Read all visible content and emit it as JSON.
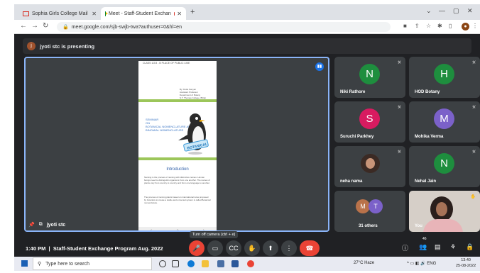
{
  "browser": {
    "tabs": [
      {
        "title": "Sophia Girls College Mail"
      },
      {
        "title": "Meet - Staff-Student Exchan"
      }
    ],
    "new_tab": "+",
    "url": "meet.google.com/sjb-swjb-twa?authuser=0&hl=en"
  },
  "meeting": {
    "presenting_avatar": "j",
    "presenting_text": "jyoti stc is presenting",
    "presenter_name": "jyoti stc",
    "time": "1:40 PM",
    "separator": "|",
    "title": "Staff-Student Exchange Program Aug. 2022",
    "tooltip": "Turn off camera (ctrl + e)",
    "raise_count": "46"
  },
  "document": {
    "cover_header": "CLASS 1/2/3 - B   PLACE OF PUBLIC LINE",
    "cover_lines": [
      "By: Dolat Kanyan",
      "Assistant Professor",
      "Department of Botany",
      "S.T. Thomas College, Bhilai"
    ],
    "page2_title": [
      "SEMINAR",
      "ON",
      "BOTANICAL NOMENCLATURE AND",
      "BINOMIAL NOMENCLATURE"
    ],
    "page2_badge": "BOTANICAL",
    "intro_heading": "Introduction",
    "intro_para1": "Naming is the process of naming with distinctive names. Human beings need to distinguish organisms from one another. The names of plants vary from country to country and from one language to another.",
    "intro_para2": "The process of naming plants based on international rules proposed by botanists to create a stable and universal system is called Botanical nomenclature.",
    "footer_pager": [
      "‹",
      "○",
      "›"
    ]
  },
  "participants": [
    {
      "initial": "N",
      "name": "Niki Rathore",
      "color": "#1e8e3e"
    },
    {
      "initial": "H",
      "name": "HOD Botany",
      "color": "#1e8e3e"
    },
    {
      "initial": "S",
      "name": "Suruchi Parkhey",
      "color": "#d81b60"
    },
    {
      "initial": "M",
      "name": "Mohika Verma",
      "color": "#7b61c9"
    },
    {
      "initial": "",
      "name": "neha nama",
      "color": "#f2f2f2"
    },
    {
      "initial": "N",
      "name": "Nehal Jain",
      "color": "#1e8e3e"
    },
    {
      "initial": "M",
      "name": "31 others",
      "color": "#b9724a"
    },
    {
      "initial": "",
      "name": "You",
      "color": "#d6cfc8"
    }
  ],
  "others_second_initial": "T",
  "taskbar": {
    "search_placeholder": "Type here to search",
    "weather": "27°C  Haze",
    "lang": "ENG",
    "time": "13:40",
    "date": "25-08-2022"
  }
}
